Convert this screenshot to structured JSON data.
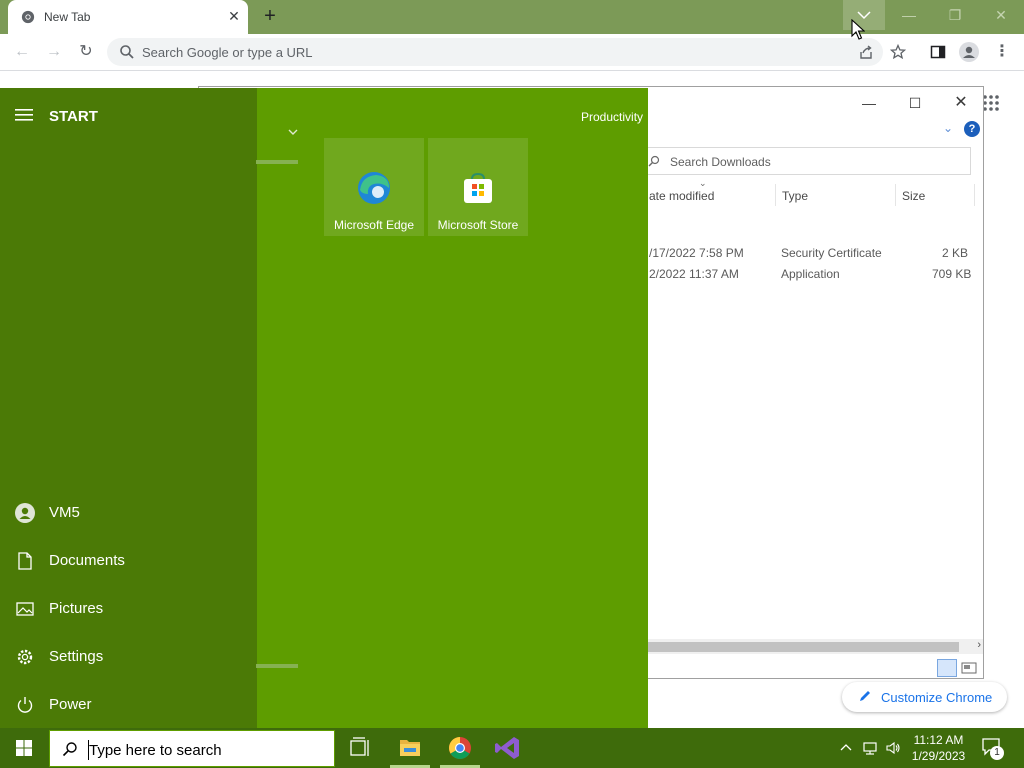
{
  "browser": {
    "tab_title": "New Tab",
    "tab_close_symbol": "✕",
    "new_tab_symbol": "+",
    "omnibox_placeholder": "Search Google or type a URL",
    "customize_label": "Customize Chrome",
    "frame_color": "#7c9a57"
  },
  "explorer": {
    "search_placeholder": "Search Downloads",
    "help_symbol": "?",
    "columns": [
      "ate modified",
      "Type",
      "Size"
    ],
    "rows": [
      {
        "date": "/17/2022 7:58 PM",
        "type": "Security Certificate",
        "size": "2 KB"
      },
      {
        "date": "2/2022 11:37 AM",
        "type": "Application",
        "size": "709 KB"
      }
    ]
  },
  "start_menu": {
    "title": "START",
    "accent_color": "#5e9d00",
    "group_title": "Productivity",
    "tiles": [
      {
        "label": "Microsoft Edge",
        "icon": "edge-icon"
      },
      {
        "label": "Microsoft Store",
        "icon": "store-icon"
      }
    ],
    "items": [
      {
        "label": "VM5",
        "icon": "user-icon"
      },
      {
        "label": "Documents",
        "icon": "document-icon"
      },
      {
        "label": "Pictures",
        "icon": "pictures-icon"
      },
      {
        "label": "Settings",
        "icon": "gear-icon"
      },
      {
        "label": "Power",
        "icon": "power-icon"
      }
    ]
  },
  "taskbar": {
    "search_placeholder": "Type here to search",
    "time": "11:12 AM",
    "date": "1/29/2023",
    "notification_count": "1",
    "color": "#3e6b0b"
  }
}
